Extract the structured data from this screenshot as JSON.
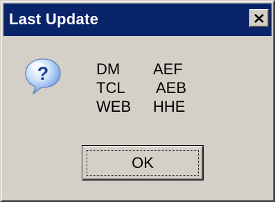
{
  "window": {
    "title": "Last Update",
    "title_bar_color": "#0a246a",
    "face_color": "#d4d0c8",
    "close_icon": "close-icon"
  },
  "dialog": {
    "icon": "question-icon",
    "message_rows": [
      {
        "left": "DM",
        "right": "AEF"
      },
      {
        "left": "TCL",
        "right": "AEB"
      },
      {
        "left": "WEB",
        "right": "HHE"
      }
    ],
    "ok_label": "OK"
  }
}
